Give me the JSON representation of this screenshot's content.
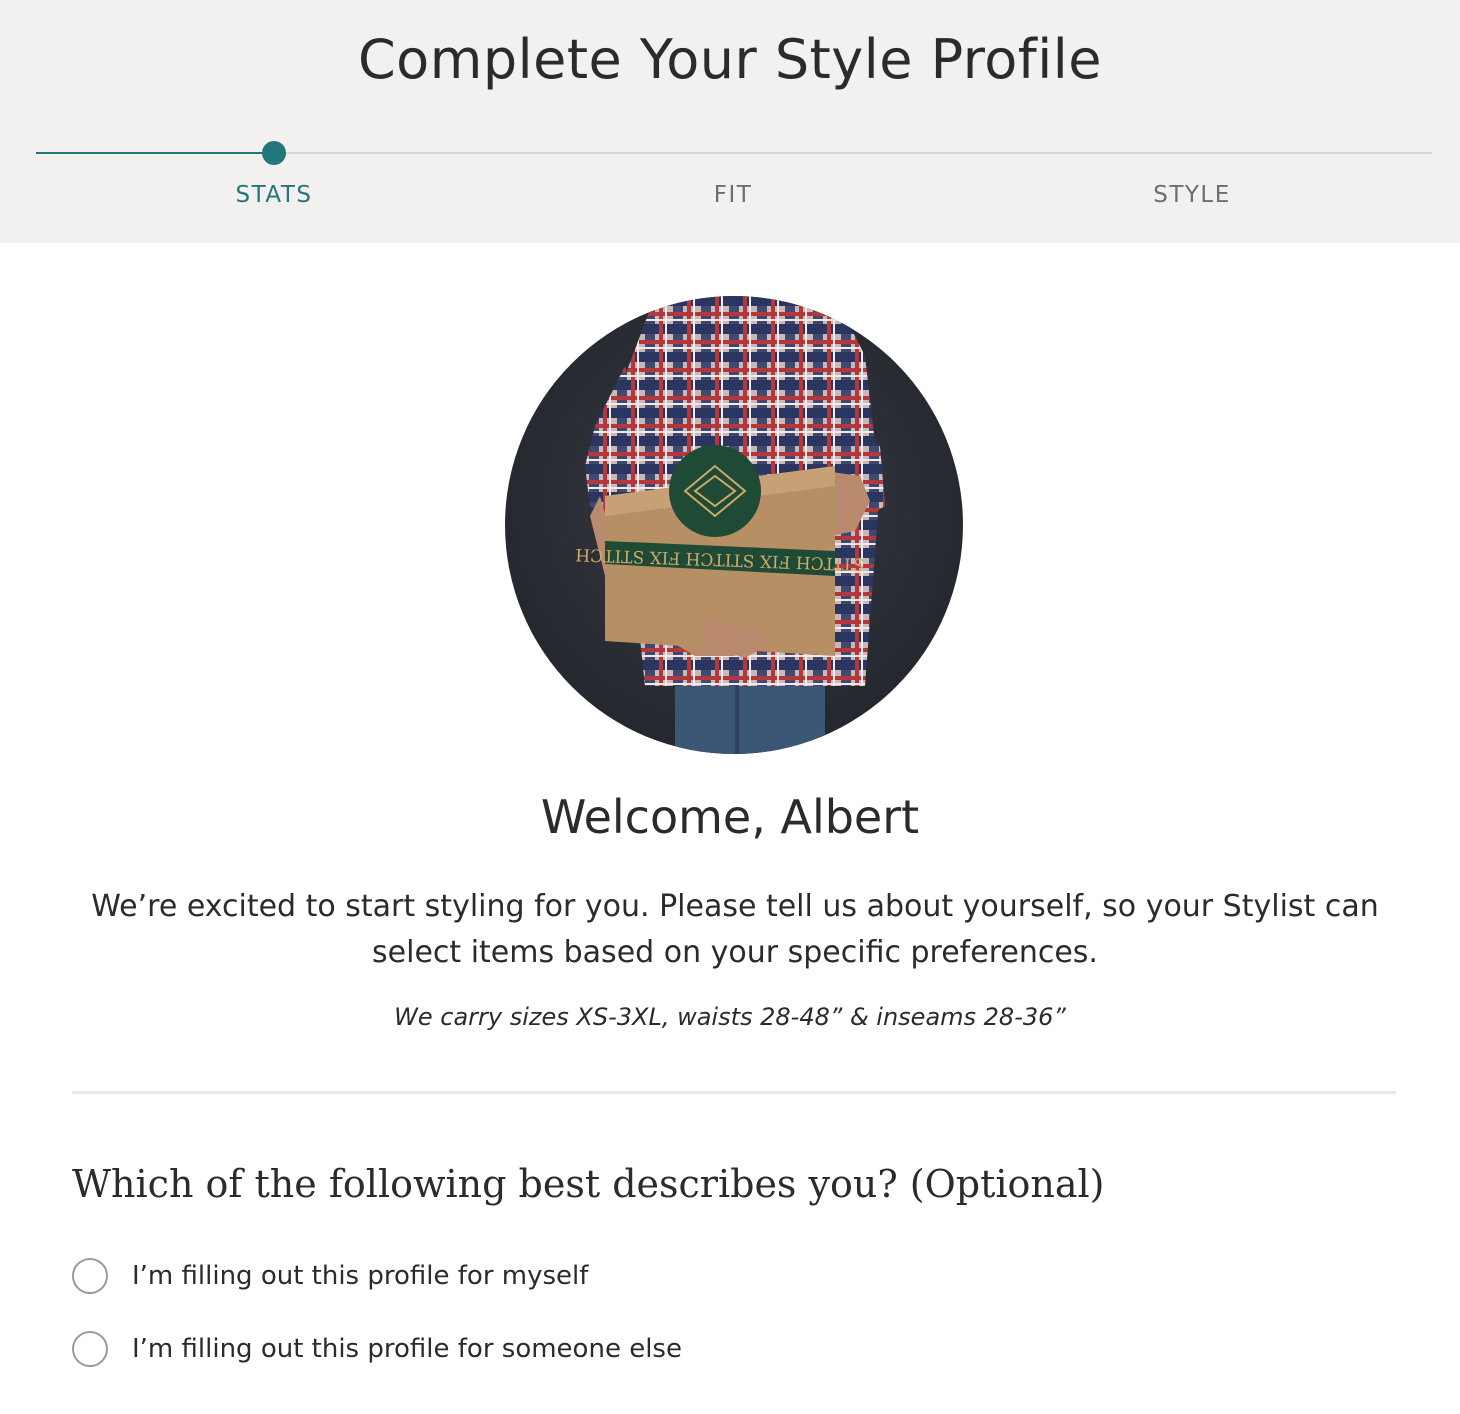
{
  "header": {
    "title": "Complete Your Style Profile",
    "steps": [
      {
        "label": "STATS",
        "active": true
      },
      {
        "label": "FIT",
        "active": false
      },
      {
        "label": "STYLE",
        "active": false
      }
    ],
    "progress_fraction": 0.17,
    "accent_color": "#22777a",
    "background_color": "#f2f1ef"
  },
  "hero": {
    "box_band_text": "STITCH FIX STITCH FIX STITCH"
  },
  "welcome": {
    "heading": "Welcome, Albert",
    "intro": "We’re excited to start styling for you. Please tell us about yourself, so your Stylist can select items based on your specific preferences.",
    "sizes_note": "We carry sizes XS-3XL, waists 28-48” & inseams 28-36”"
  },
  "question": {
    "prompt": "Which of the following best describes you? (Optional)",
    "options": [
      {
        "label": "I’m filling out this profile for myself",
        "selected": false
      },
      {
        "label": "I’m filling out this profile for someone else",
        "selected": false
      }
    ]
  }
}
